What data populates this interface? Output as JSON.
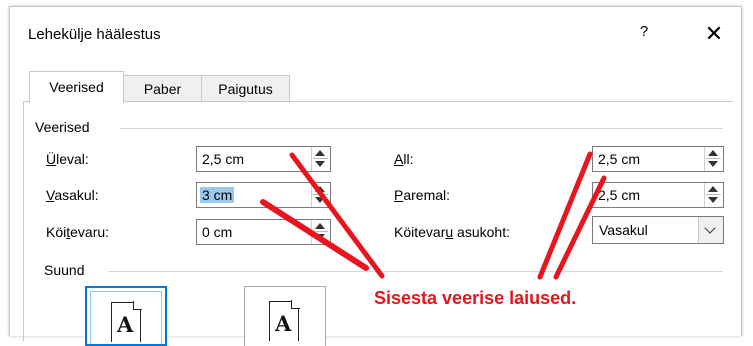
{
  "dialog": {
    "title": "Lehekülje häälestus",
    "help_label": "?",
    "close_label": "✕"
  },
  "tabs": [
    {
      "label": "Veerised",
      "active": true
    },
    {
      "label": "Paber",
      "active": false
    },
    {
      "label": "Paigutus",
      "active": false
    }
  ],
  "margins": {
    "group_label": "Veerised",
    "left_fields": [
      {
        "pre": "",
        "key": "Ü",
        "post": "leval:",
        "value": "2,5 cm",
        "selected": false
      },
      {
        "pre": "",
        "key": "V",
        "post": "asakul:",
        "value": "3 cm",
        "selected": true
      },
      {
        "pre": "Köi",
        "key": "t",
        "post": "evaru:",
        "value": "0 cm",
        "selected": false
      }
    ],
    "right_fields": [
      {
        "pre": "",
        "key": "A",
        "post": "ll:",
        "value": "2,5 cm"
      },
      {
        "pre": "",
        "key": "P",
        "post": "aremal:",
        "value": "2,5 cm"
      }
    ],
    "gutter_position": {
      "pre": "Köitevar",
      "key": "u",
      "post": " asukoht:",
      "value": "Vasakul"
    }
  },
  "orientation": {
    "group_label": "Suund",
    "icon_letter": "A"
  },
  "annotation": {
    "text": "Sisesta veerise laiused.",
    "color": "#e8141e"
  }
}
